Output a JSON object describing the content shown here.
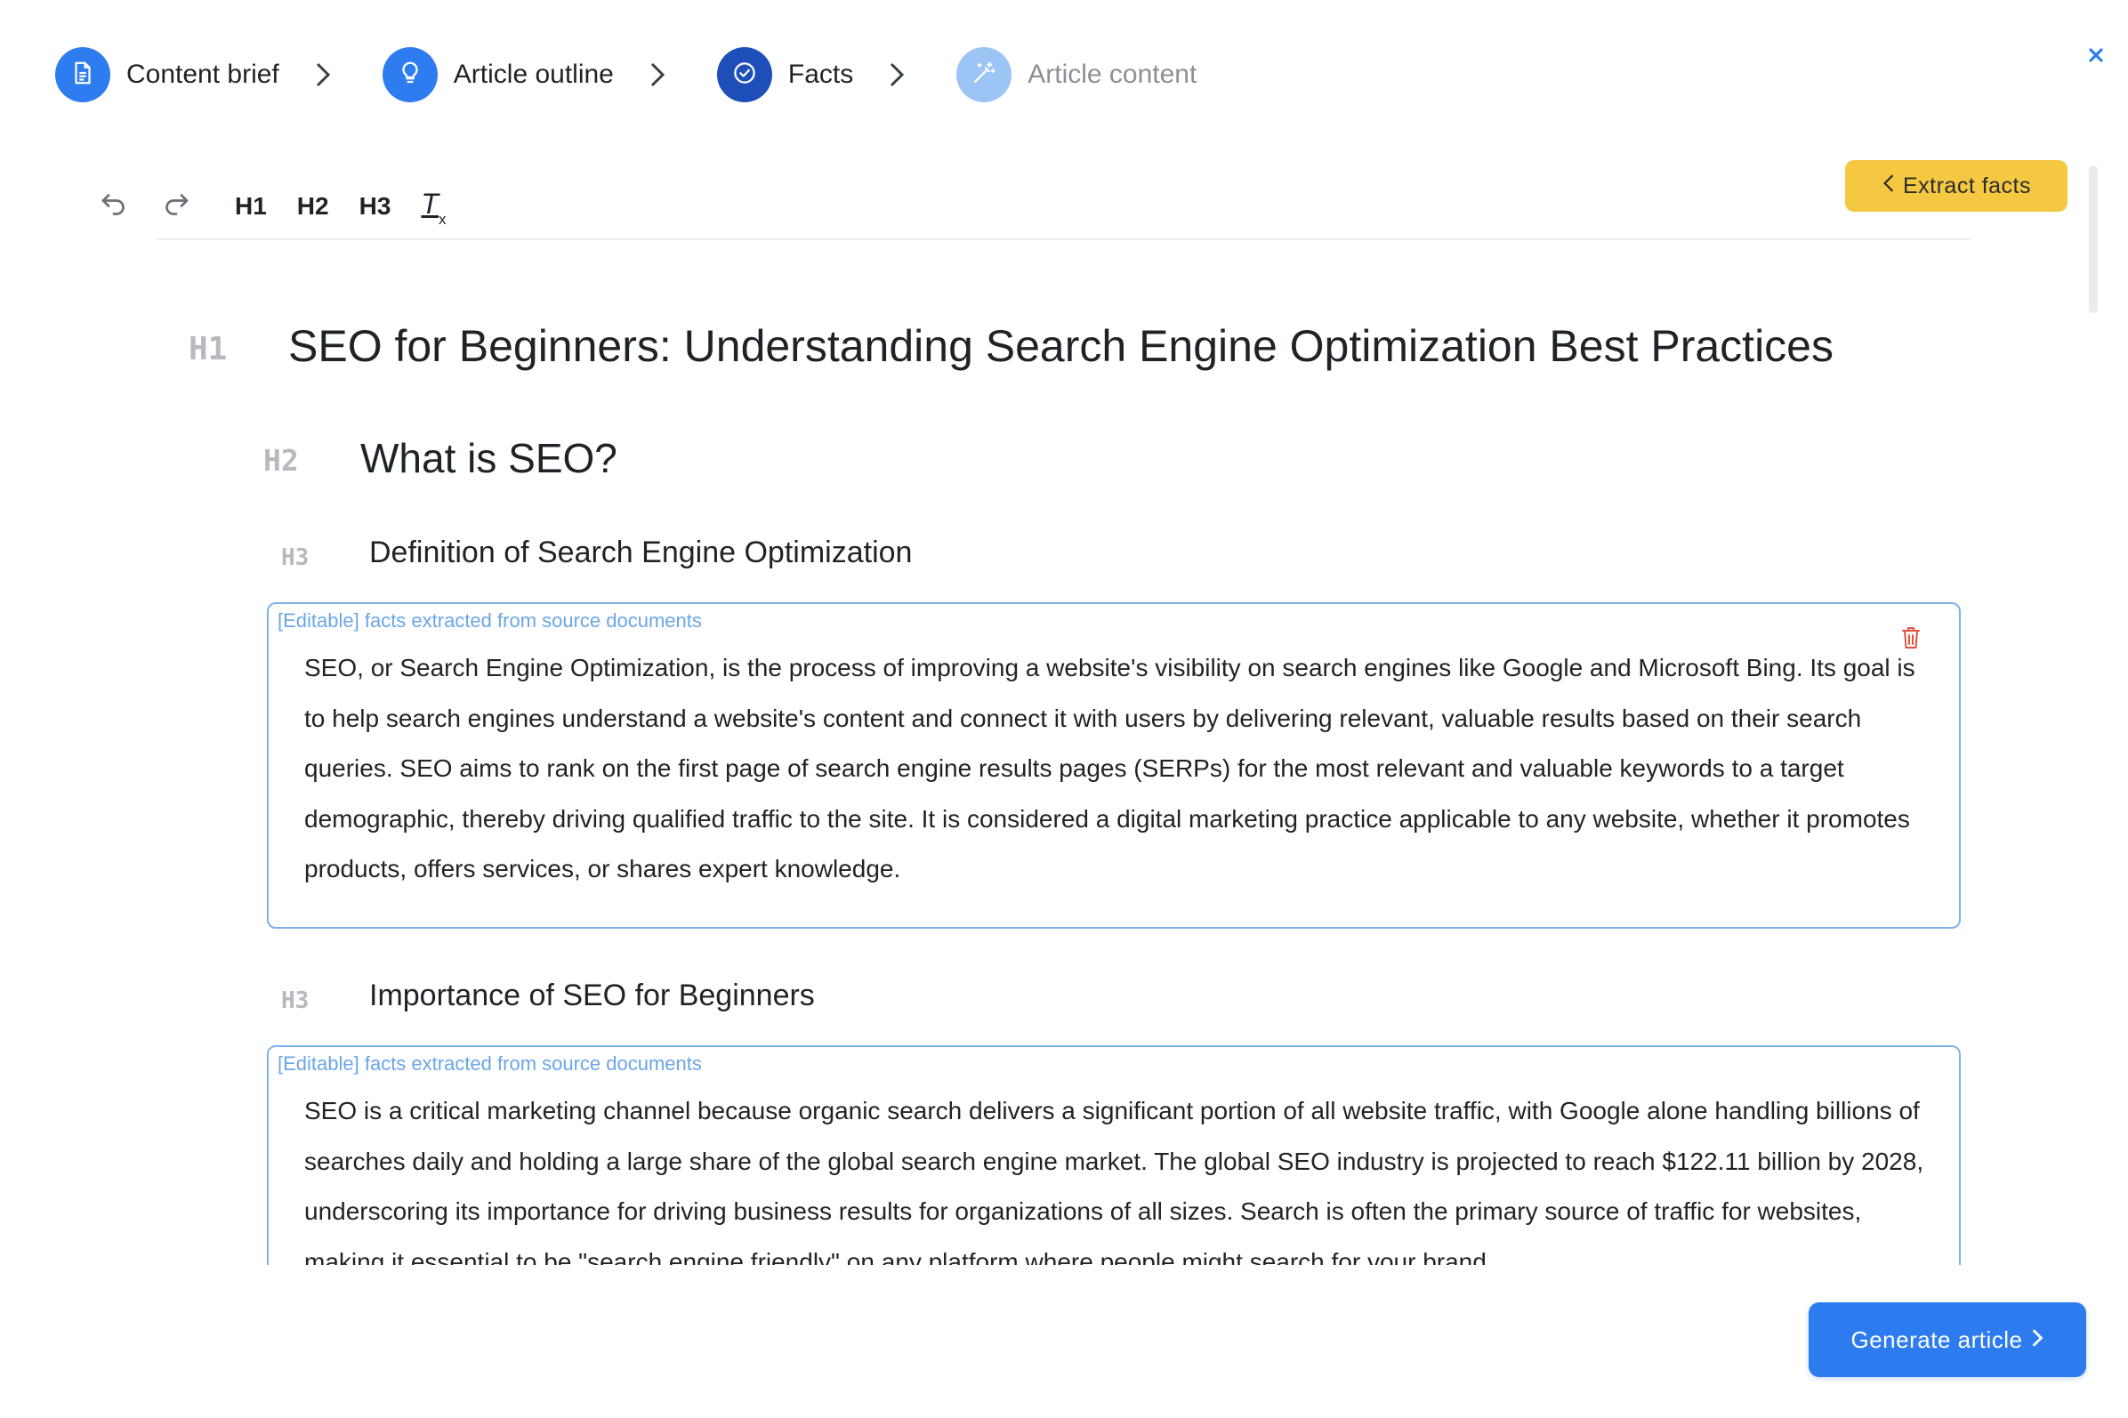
{
  "colors": {
    "accent_blue": "#2c7cf0",
    "step_done_blue": "#2d7cf0",
    "step_current_blue": "#1e4fb8",
    "step_pending_blue": "#9cc4f5",
    "extract_yellow": "#f5c842",
    "facts_border": "#7fb2ec",
    "delete_red": "#e0533d"
  },
  "stepper": {
    "steps": [
      {
        "label": "Content brief",
        "icon": "document-icon",
        "state": "done"
      },
      {
        "label": "Article outline",
        "icon": "lightbulb-icon",
        "state": "done"
      },
      {
        "label": "Facts",
        "icon": "check-circle-icon",
        "state": "current"
      },
      {
        "label": "Article content",
        "icon": "magic-wand-icon",
        "state": "pending"
      }
    ]
  },
  "toolbar": {
    "undo_icon": "undo-icon",
    "redo_icon": "redo-icon",
    "h1": "H1",
    "h2": "H2",
    "h3": "H3",
    "clear_format": "T",
    "clear_format_sub": "x",
    "extract_facts_label": "Extract facts"
  },
  "document": {
    "h1": {
      "tag": "H1",
      "text": "SEO for Beginners: Understanding Search Engine Optimization Best Practices"
    },
    "h2": {
      "tag": "H2",
      "text": "What is SEO?"
    },
    "sections": [
      {
        "tag": "H3",
        "title": "Definition of Search Engine Optimization",
        "facts_caption": "[Editable] facts extracted from source documents",
        "facts": "SEO, or Search Engine Optimization, is the process of improving a website's visibility on search engines like Google and Microsoft Bing. Its goal is to help search engines understand a website's content and connect it with users by delivering relevant, valuable results based on their search queries. SEO aims to rank on the first page of search engine results pages (SERPs) for the most relevant and valuable keywords to a target demographic, thereby driving qualified traffic to the site. It is considered a digital marketing practice applicable to any website, whether it promotes products, offers services, or shares expert knowledge."
      },
      {
        "tag": "H3",
        "title": "Importance of SEO for Beginners",
        "facts_caption": "[Editable] facts extracted from source documents",
        "facts": "SEO is a critical marketing channel because organic search delivers a significant portion of all website traffic, with Google alone handling billions of searches daily and holding a large share of the global search engine market. The global SEO industry is projected to reach $122.11 billion by 2028, underscoring its importance for driving business results for organizations of all sizes. Search is often the primary source of traffic for websites, making it essential to be \"search engine friendly\" on any platform where people might search for your brand."
      }
    ]
  },
  "footer": {
    "generate_label": "Generate article"
  }
}
